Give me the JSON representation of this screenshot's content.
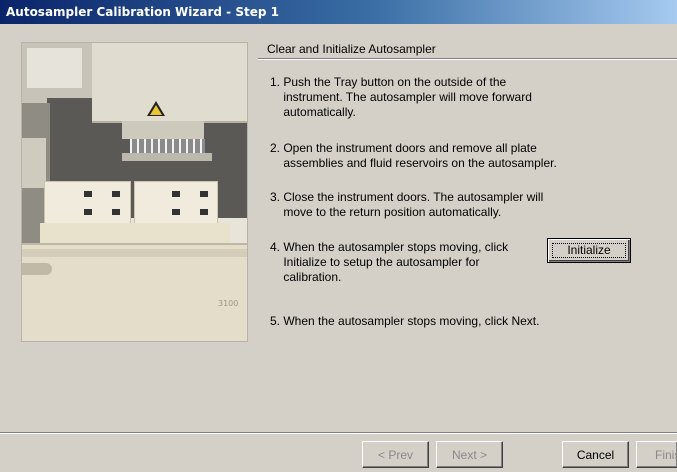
{
  "window": {
    "title": "Autosampler Calibration Wizard - Step 1"
  },
  "photo": {
    "label_text": "3100"
  },
  "panel": {
    "heading": "Clear and Initialize Autosampler",
    "steps": [
      "1. Push the Tray button on the outside of the\n    instrument. The autosampler will move forward\n    automatically.",
      "2. Open the instrument doors and remove all plate\n    assemblies and fluid reservoirs on the autosampler.",
      "3. Close the instrument doors. The autosampler will\n    move to the return position automatically.",
      "4. When the autosampler stops moving, click\n    Initialize to setup the autosampler for\n    calibration.",
      "5. When the autosampler stops moving, click Next."
    ],
    "initialize_label": "Initialize"
  },
  "footer": {
    "prev_label": "< Prev",
    "next_label": "Next >",
    "cancel_label": "Cancel",
    "finish_label": "Finis"
  }
}
